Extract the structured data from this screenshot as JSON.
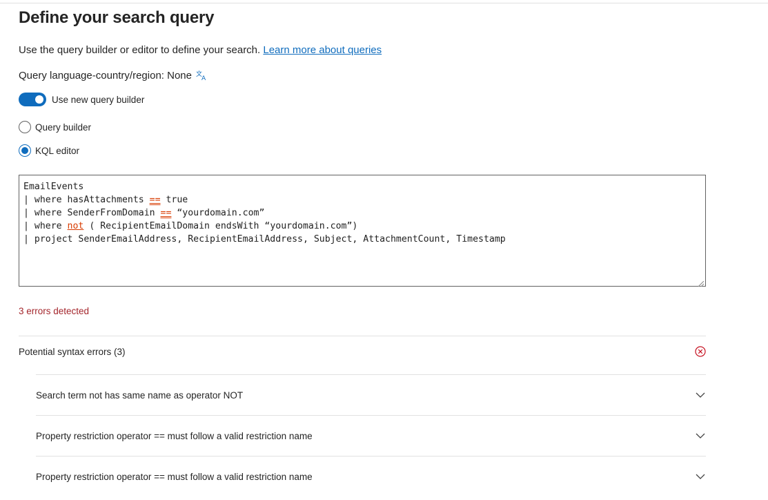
{
  "page": {
    "title": "Define your search query",
    "description": "Use the query builder or editor to define your search. ",
    "learn_more_link": "Learn more about queries",
    "language_label": "Query language-country/region: None"
  },
  "toggle": {
    "label": "Use new query builder",
    "on": true
  },
  "radios": [
    {
      "label": "Query builder",
      "checked": false
    },
    {
      "label": "KQL editor",
      "checked": true
    }
  ],
  "editor": {
    "lines": [
      "EmailEvents",
      "where hasAttachments == true",
      "where SenderFromDomain == “yourdomain.com”",
      "where not ( RecipientEmailDomain endsWith “yourdomain.com”)",
      "project SenderEmailAddress, RecipientEmailAddress, Subject, AttachmentCount, Timestamp"
    ],
    "l1_a": "where hasAttachments ",
    "l1_err": "==",
    "l1_b": " true",
    "l2_a": "where SenderFromDomain ",
    "l2_err": "==",
    "l2_b": " “yourdomain.com”",
    "l3_a": "where ",
    "l3_err": "not",
    "l3_b": " ( RecipientEmailDomain endsWith “yourdomain.com”)",
    "l4": "project SenderEmailAddress, RecipientEmailAddress, Subject, AttachmentCount, Timestamp",
    "pipe": "|"
  },
  "errors": {
    "count_text": "3 errors detected",
    "section_title": "Potential syntax errors (3)",
    "items": [
      "Search term not has same name as operator NOT",
      "Property restriction operator == must follow a valid restriction name",
      "Property restriction operator == must follow a valid restriction name"
    ]
  },
  "colors": {
    "accent": "#0f6cbd",
    "error_text": "#a4262c",
    "error_underline": "#d83b01"
  },
  "icons": {
    "language": "translate-icon",
    "dismiss": "error-circle-icon",
    "expand": "chevron-down-icon"
  }
}
